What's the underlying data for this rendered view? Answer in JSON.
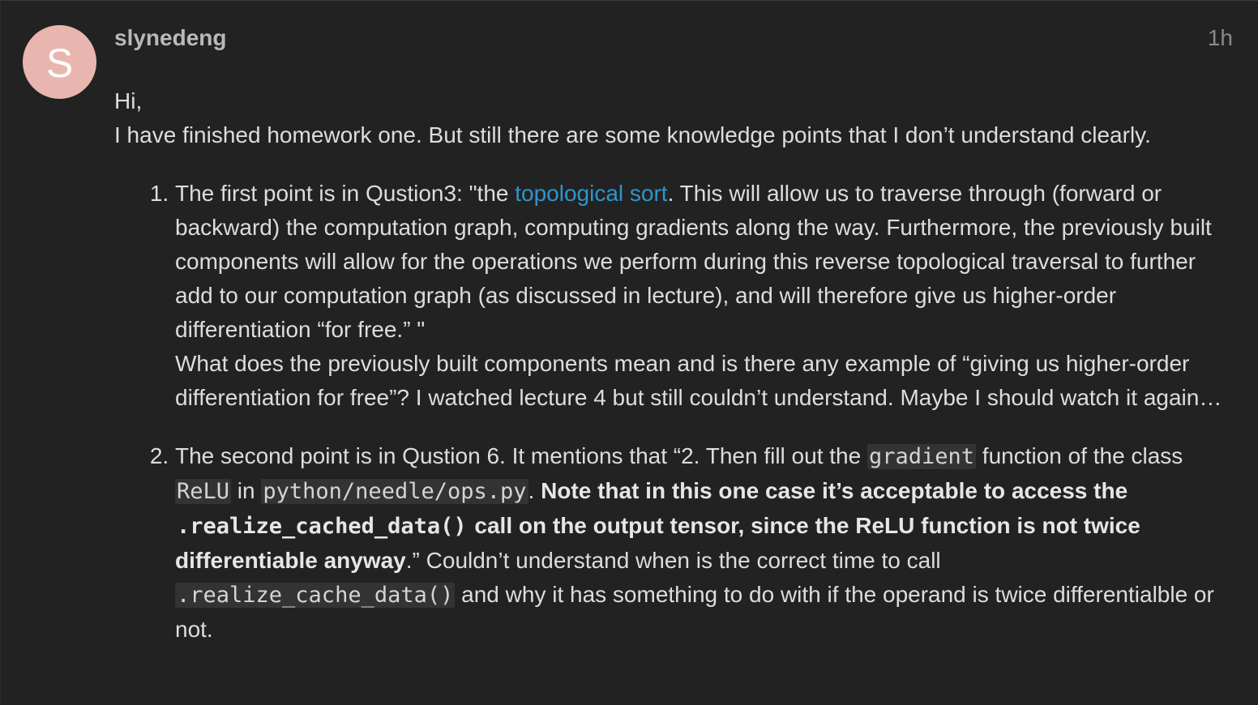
{
  "post": {
    "author": "slynedeng",
    "avatar_letter": "S",
    "avatar_color": "#e8b6ae",
    "time": "1h",
    "greeting": "Hi,",
    "intro": "I have finished homework one. But still there are some knowledge points that I don’t understand clearly.",
    "link_color": "#2f95cc",
    "items": [
      {
        "a_prefix": "The first point is in Qustion3: \"the ",
        "a_link": "topological sort",
        "a_suffix": ". This will allow us to traverse through (forward or backward) the computation graph, computing gradients along the way. Furthermore, the previously built components will allow for the operations we perform during this reverse topological traversal to further add to our computation graph (as discussed in lecture), and will therefore give us higher-order differentiation “for free.” \"",
        "b": "What does the previously built components mean and is there any example of “giving us higher-order differentiation for free”? I watched lecture 4 but still couldn’t understand. Maybe I should watch it again…"
      },
      {
        "t1": "The second point is in Qustion 6. It mentions that “2. Then fill out the ",
        "c1": "gradient",
        "t2": " function of the class ",
        "c2": "ReLU",
        "t3": " in ",
        "c3": "python/needle/ops.py",
        "t4": ". ",
        "b1": "Note that in this one case it’s acceptable to access the ",
        "bc": ".realize_cached_data()",
        "b2": " call on the output tensor, since the ReLU function is not twice differentiable anyway",
        "t5": ".” Couldn’t understand when is the correct time to call ",
        "c4": ".realize_cache_data()",
        "t6": " and why it has something to do with if the operand is twice differentialble or not."
      }
    ]
  }
}
